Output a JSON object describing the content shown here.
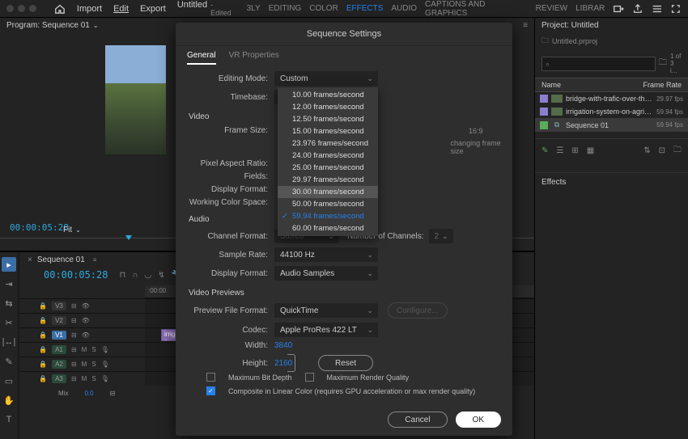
{
  "topbar": {
    "home": "⌂",
    "import": "Import",
    "edit": "Edit",
    "export": "Export",
    "doc_title": "Untitled",
    "doc_status": "Edited",
    "tabs": [
      "3LY",
      "EDITING",
      "COLOR",
      "EFFECTS",
      "AUDIO",
      "CAPTIONS AND GRAPHICS",
      "REVIEW",
      "LIBRAR"
    ]
  },
  "program": {
    "title": "Program: Sequence 01",
    "timecode": "00:00:05:28",
    "fit": "Fit"
  },
  "timeline": {
    "tab": "Sequence 01",
    "timecode": "00:00:05:28",
    "ruler0": ":00:00",
    "clip": "irrigation-s",
    "tracks": {
      "v3": "V3",
      "v2": "V2",
      "v1": "V1",
      "a1": "A1",
      "a2": "A2",
      "a3": "A3",
      "mix": "Mix",
      "mix_val": "0.0"
    },
    "ctrls": {
      "eye": "⏵",
      "lock": "⏴",
      "m": "M",
      "s": "S",
      "mic": "🎙",
      "fx": "ƒx"
    }
  },
  "project": {
    "title": "Project: Untitled",
    "file": "Untitled.prproj",
    "search_ph": "⌕",
    "pager": "1 of 3 i...",
    "col_name": "Name",
    "col_rate": "Frame Rate",
    "items": [
      {
        "name": "bridge-with-trafic-over-the-r",
        "rate": "29.97 fps"
      },
      {
        "name": "irrigation-system-on-agricult",
        "rate": "59.94 fps"
      },
      {
        "name": "Sequence 01",
        "rate": "59.94 fps"
      }
    ],
    "effects_panel": "Effects"
  },
  "dialog": {
    "title": "Sequence Settings",
    "tabs": {
      "general": "General",
      "vr": "VR Properties"
    },
    "labels": {
      "editing_mode": "Editing Mode:",
      "timebase": "Timebase:",
      "video": "Video",
      "frame_size": "Frame Size:",
      "aspect_note": "16:9",
      "scale_note": "changing frame size",
      "pixel_aspect": "Pixel Aspect Ratio:",
      "fields": "Fields:",
      "display_format_v": "Display Format:",
      "color_space": "Working Color Space:",
      "audio": "Audio",
      "channel_format": "Channel Format:",
      "num_channels": "Number of Channels:",
      "sample_rate": "Sample Rate:",
      "display_format_a": "Display Format:",
      "previews": "Video Previews",
      "preview_format": "Preview File Format:",
      "codec": "Codec:",
      "width": "Width:",
      "height": "Height:",
      "configure": "Configure...",
      "reset": "Reset",
      "max_bit": "Maximum Bit Depth",
      "max_render": "Maximum Render Quality",
      "composite": "Composite in Linear Color (requires GPU acceleration or max render quality)",
      "cancel": "Cancel",
      "ok": "OK"
    },
    "values": {
      "editing_mode": "Custom",
      "timebase": "59.94  frames/second",
      "channel_format": "Stereo",
      "num_channels": "2",
      "sample_rate": "44100 Hz",
      "display_format_a": "Audio Samples",
      "preview_format": "QuickTime",
      "codec": "Apple ProRes 422 LT",
      "width": "3840",
      "height": "2160"
    },
    "timebase_options": [
      "10.00  frames/second",
      "12.00  frames/second",
      "12.50  frames/second",
      "15.00  frames/second",
      "23.976  frames/second",
      "24.00  frames/second",
      "25.00  frames/second",
      "29.97  frames/second",
      "30.00  frames/second",
      "50.00  frames/second",
      "59.94  frames/second",
      "60.00  frames/second"
    ],
    "timebase_highlight": 8,
    "timebase_selected": 10
  }
}
